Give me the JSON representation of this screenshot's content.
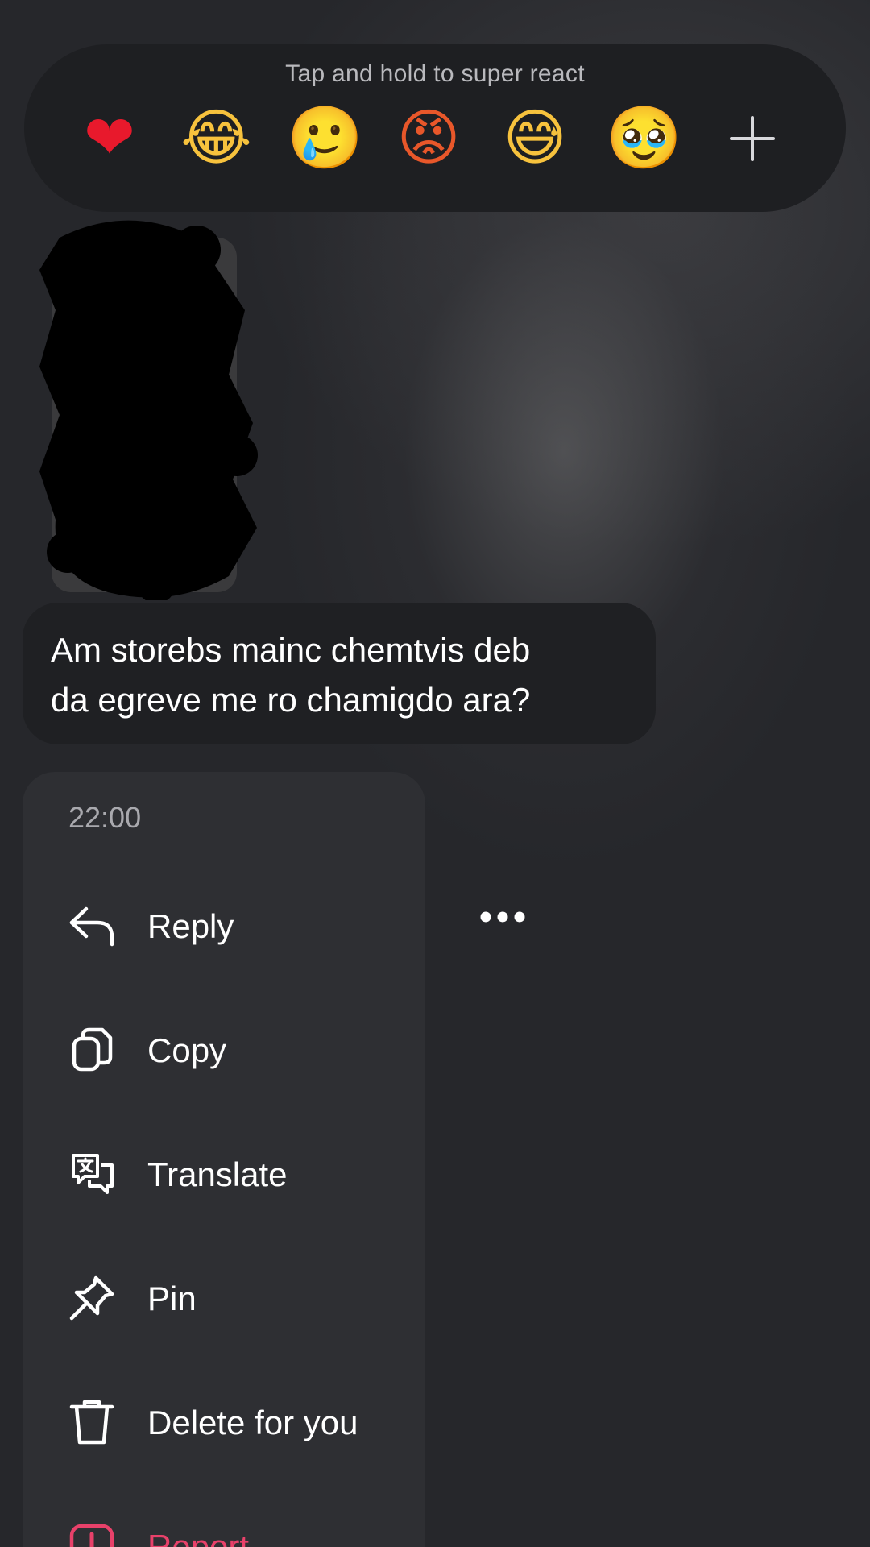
{
  "reactions": {
    "hint": "Tap and hold to super react",
    "emojis": [
      {
        "name": "red-heart",
        "glyph": "❤"
      },
      {
        "name": "face-with-tears-of-joy",
        "glyph": "😂"
      },
      {
        "name": "smiling-face-with-tear",
        "glyph": "🥲"
      },
      {
        "name": "pouting-face",
        "glyph": "😡"
      },
      {
        "name": "grinning-face-with-sweat",
        "glyph": "😅"
      },
      {
        "name": "pleading-face",
        "glyph": "🥹"
      }
    ],
    "add_icon": "plus-icon"
  },
  "message": {
    "line1": "Am storebs mainc chemtvis deb",
    "line2": "da egreve me ro chamigdo ara?"
  },
  "menu": {
    "time": "22:00",
    "items": [
      {
        "label": "Reply",
        "icon": "reply-icon"
      },
      {
        "label": "Copy",
        "icon": "copy-icon"
      },
      {
        "label": "Translate",
        "icon": "translate-icon"
      },
      {
        "label": "Pin",
        "icon": "pin-icon"
      },
      {
        "label": "Delete for you",
        "icon": "trash-icon"
      },
      {
        "label": "Report",
        "icon": "report-icon"
      }
    ]
  },
  "more_icon": "more-icon",
  "colors": {
    "background": "#26272b",
    "menu": "#2e2f33",
    "bubble": "#1f2023",
    "danger": "#e8416a"
  }
}
